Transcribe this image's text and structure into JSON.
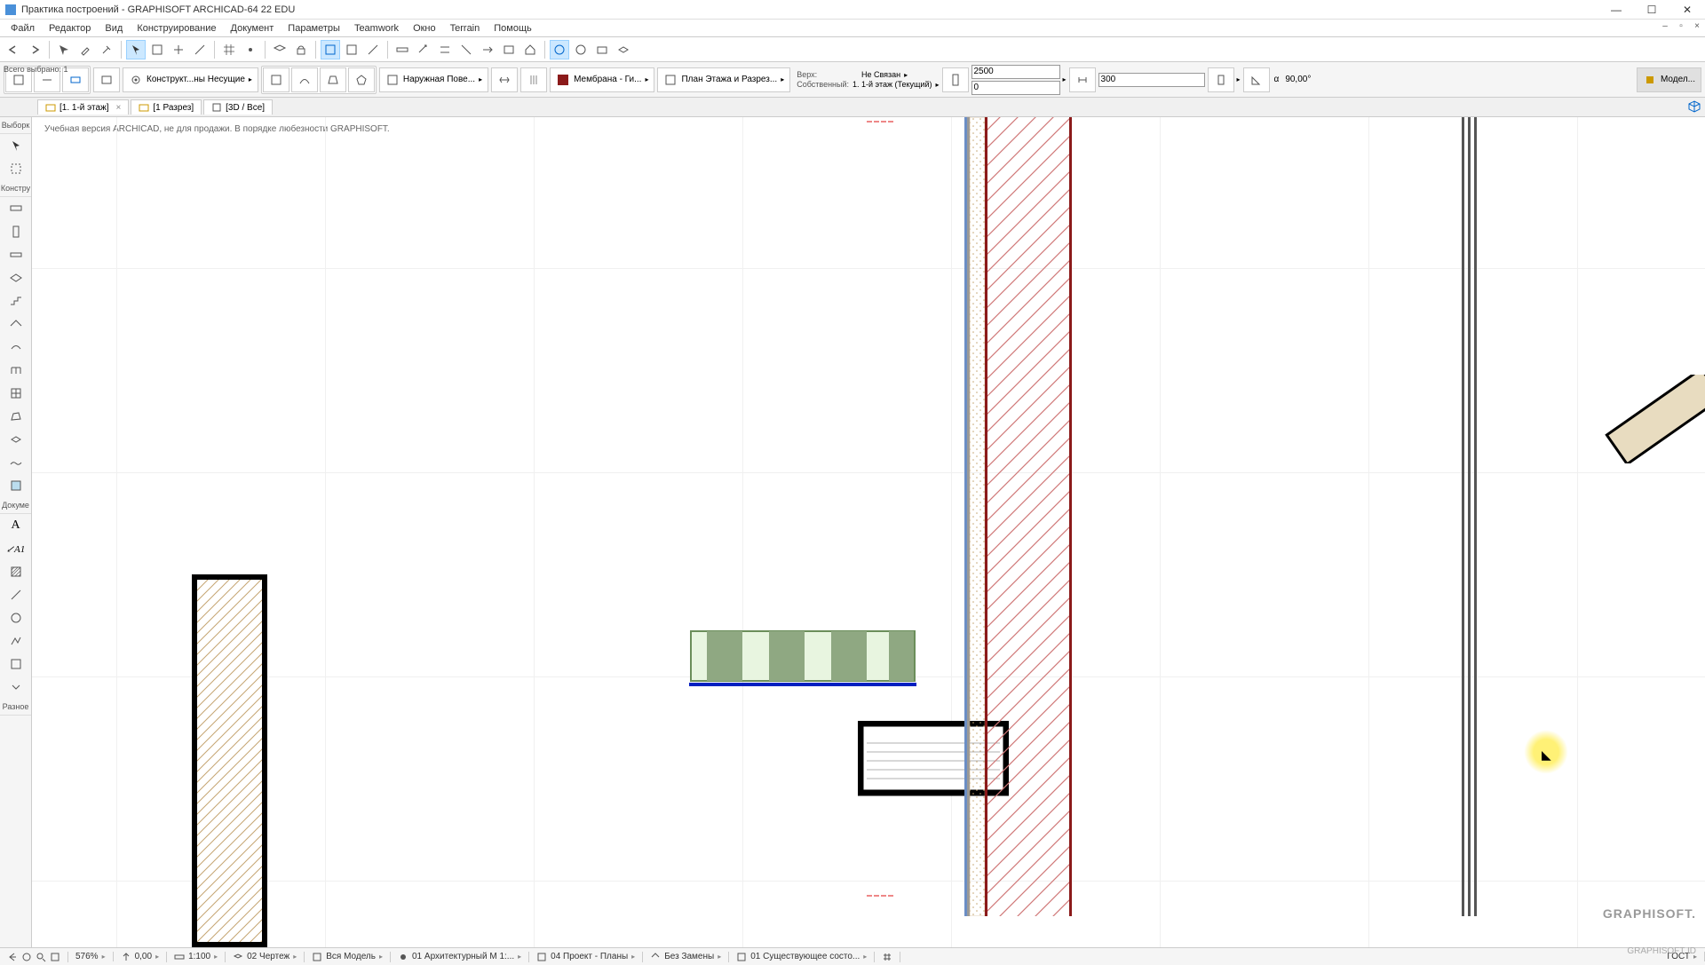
{
  "title": "Практика построений - GRAPHISOFT ARCHICAD-64 22 EDU",
  "menu": [
    "Файл",
    "Редактор",
    "Вид",
    "Конструирование",
    "Документ",
    "Параметры",
    "Teamwork",
    "Окно",
    "Terrain",
    "Помощь"
  ],
  "selection_label": "Всего выбрано: 1",
  "toolbar2": {
    "layer": "Конструкт...ны Несущие",
    "profile": "Наружная Пове...",
    "membrane": "Мембрана - Ги...",
    "plan": "План Этажа и Разрез...",
    "link_top": "Верх:",
    "link_top_val": "Не Связан",
    "link_own": "Собственный:",
    "link_own_val": "1. 1-й этаж (Текущий)",
    "height1": "2500",
    "height2": "0",
    "thickness": "300",
    "angle": "90,00°",
    "model_btn": "Модел..."
  },
  "tabs": [
    {
      "label": "[1. 1-й этаж]",
      "active": true,
      "closeable": true
    },
    {
      "label": "[1 Разрез]",
      "active": false,
      "closeable": false
    },
    {
      "label": "[3D / Все]",
      "active": false,
      "closeable": false
    }
  ],
  "toolbox": {
    "select_header": "Выборк",
    "construct_header": "Констру",
    "doc_header": "Докуме",
    "misc_header": "Разное"
  },
  "notice": "Учебная версия ARCHICAD, не для продажи. В порядке любезности GRAPHISOFT.",
  "statusbar": {
    "zoom": "576%",
    "elevation": "0,00",
    "scale": "1:100",
    "layer_combo": "02 Чертеж",
    "model": "Вся Модель",
    "view1": "01 Архитектурный М 1:...",
    "view2": "04 Проект - Планы",
    "filter": "Без Замены",
    "state": "01 Существующее состо...",
    "standard": "ГОСТ"
  },
  "brand": "GRAPHISOFT.",
  "brand_id": "GRAPHISOFT ID"
}
